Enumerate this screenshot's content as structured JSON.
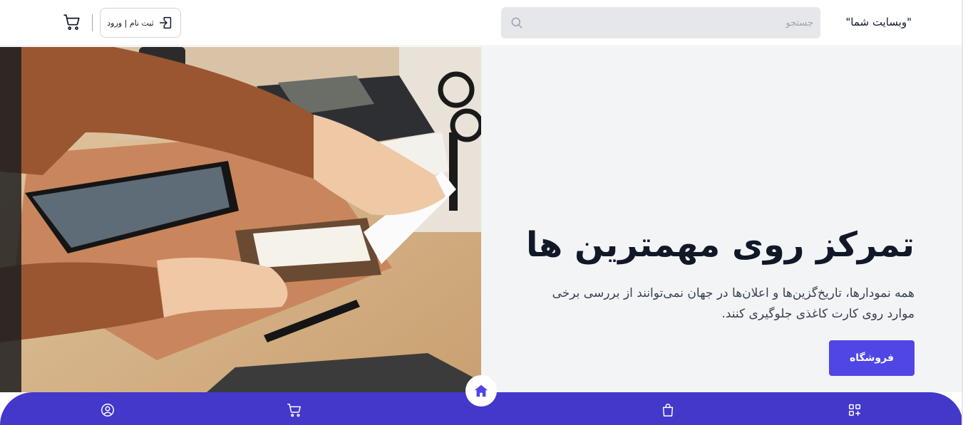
{
  "header": {
    "brand": "\"وبسایت شما\"",
    "search_placeholder": "جستجو",
    "login_label": "ثبت نام | ورود"
  },
  "hero": {
    "title": "تمرکز روی مهمترین ها",
    "text": "همه نمودارها، تاریخ‌گزین‌ها و اعلان‌ها در جهان نمی‌توانند از بررسی برخی موارد روی کارت کاغذی جلوگیری کنند.",
    "shop_button": "فروشگاه"
  },
  "bottom_nav": {
    "items": [
      {
        "icon": "user-circle-icon"
      },
      {
        "icon": "cart-icon"
      },
      {
        "icon": "home-icon"
      },
      {
        "icon": "shopping-bag-icon"
      },
      {
        "icon": "grid-plus-icon"
      }
    ]
  },
  "colors": {
    "accent": "#4f46e5",
    "nav_bg": "#4338ca",
    "hero_bg": "#f3f4f6",
    "search_bg": "#e5e7eb"
  }
}
